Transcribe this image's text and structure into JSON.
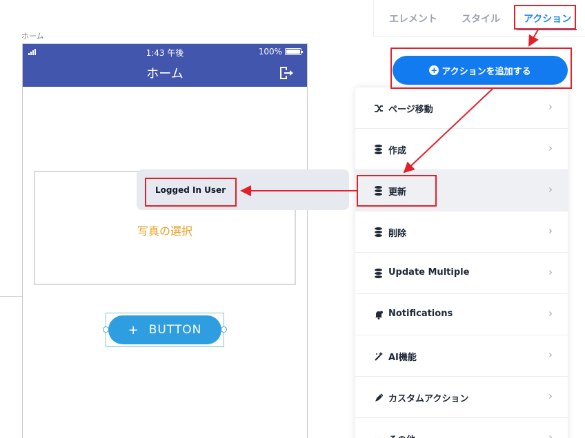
{
  "canvas": {
    "screen_label": "ホーム"
  },
  "phone": {
    "status": {
      "time": "1:43 午後",
      "battery": "100%"
    },
    "header_title": "ホーム",
    "photo_text": "写真の選択",
    "button_label": "BUTTON",
    "button_plus": "+"
  },
  "tabs": {
    "element": "エレメント",
    "style": "スタイル",
    "action": "アクション"
  },
  "add_action_label": "アクションを追加する",
  "menu": {
    "items": [
      {
        "label": "ページ移動",
        "icon": "shuffle-icon"
      },
      {
        "label": "作成",
        "icon": "database-icon"
      },
      {
        "label": "更新",
        "icon": "database-icon"
      },
      {
        "label": "削除",
        "icon": "database-icon"
      },
      {
        "label": "Update Multiple",
        "icon": "database-icon"
      },
      {
        "label": "Notifications",
        "icon": "bell-icon"
      },
      {
        "label": "AI機能",
        "icon": "magic-wand-icon"
      },
      {
        "label": "カスタムアクション",
        "icon": "pen-icon"
      },
      {
        "label": "その他",
        "icon": "more-icon"
      }
    ],
    "chevron": "›"
  },
  "submenu": {
    "label": "Logged In User"
  },
  "colors": {
    "header_bg": "#4356ad",
    "accent": "#137bf0",
    "annotation": "#e3202a",
    "photo_text": "#e8a223",
    "button_bg": "#2e9ee0"
  }
}
